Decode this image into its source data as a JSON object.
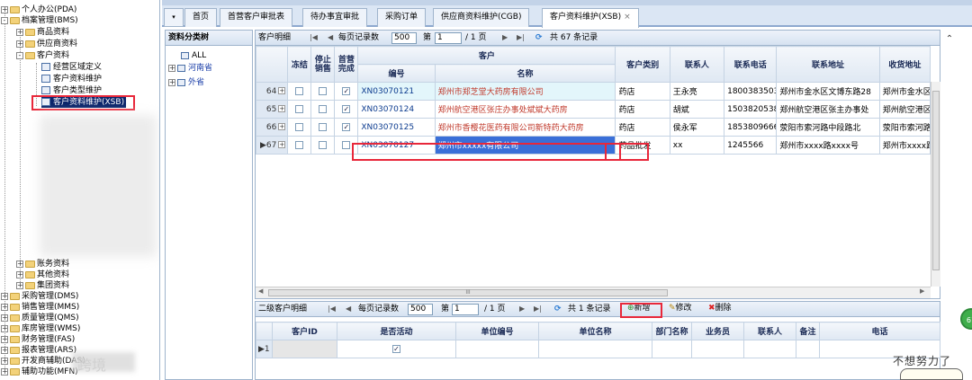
{
  "nav": {
    "items": [
      {
        "label": "个人办公(PDA)",
        "expander": "+",
        "level": 0
      },
      {
        "label": "档案管理(BMS)",
        "expander": "-",
        "level": 0
      },
      {
        "label": "商品资料",
        "expander": "+",
        "level": 1
      },
      {
        "label": "供应商资料",
        "expander": "+",
        "level": 1
      },
      {
        "label": "客户资料",
        "expander": "-",
        "level": 1
      },
      {
        "label": "经营区域定义",
        "level": 2
      },
      {
        "label": "客户资料维护",
        "level": 2
      },
      {
        "label": "客户类型维护",
        "level": 2
      },
      {
        "label": "客户资料维护(XSB)",
        "level": 2
      },
      {
        "label": "账务资料",
        "expander": "+",
        "level": 1
      },
      {
        "label": "其他资料",
        "expander": "+",
        "level": 1
      },
      {
        "label": "集团资料",
        "expander": "+",
        "level": 1
      },
      {
        "label": "采购管理(DMS)",
        "expander": "+",
        "level": 0
      },
      {
        "label": "销售管理(MMS)",
        "expander": "+",
        "level": 0
      },
      {
        "label": "质量管理(QMS)",
        "expander": "+",
        "level": 0
      },
      {
        "label": "库房管理(WMS)",
        "expander": "+",
        "level": 0
      },
      {
        "label": "财务管理(FAS)",
        "expander": "+",
        "level": 0
      },
      {
        "label": "报表管理(ARS)",
        "expander": "+",
        "level": 0
      },
      {
        "label": "开发商辅助(DAS)",
        "expander": "+",
        "level": 0
      },
      {
        "label": "辅助功能(MFN)",
        "expander": "+",
        "level": 0
      }
    ],
    "watermark": "跨境"
  },
  "tabs": {
    "dropdown": "▾",
    "items": [
      {
        "label": "首页"
      },
      {
        "label": "首营客户审批表"
      },
      {
        "label": "待办事宜审批"
      },
      {
        "label": "采购订单"
      },
      {
        "label": "供应商资料维护(CGB)"
      },
      {
        "label": "客户资料维护(XSB)",
        "close": "×",
        "active": true
      }
    ]
  },
  "category": {
    "header": "资料分类树",
    "all": "ALL",
    "nodes": [
      "河南省",
      "外省"
    ]
  },
  "main": {
    "title": "客户明细",
    "page_size_label": "每页记录数",
    "page_size": "500",
    "page_prefix": "第",
    "page": "1",
    "page_total": "/ 1 页",
    "total_label": "共 67 条记录",
    "headers": {
      "frozen": "冻结",
      "stop_sale": "停止销售",
      "first_done": "首营完成",
      "customer": "客户",
      "code": "编号",
      "name": "名称",
      "type": "客户类别",
      "contact": "联系人",
      "phone": "联系电话",
      "address": "联系地址",
      "ship_address": "收货地址"
    },
    "rows": [
      {
        "no": "64",
        "first": "✓",
        "code": "XN03070121",
        "name": "郑州市郑芝堂大药房有限公司",
        "type": "药店",
        "contact": "王永亮",
        "phone": "18003835035",
        "address": "郑州市金水区文博东路28",
        "ship": "郑州市金水区"
      },
      {
        "no": "65",
        "first": "✓",
        "code": "XN03070124",
        "name": "郑州航空港区张庄办事处斌斌大药房",
        "type": "药店",
        "contact": "胡斌",
        "phone": "15038205385",
        "address": "郑州航空港区张主办事处",
        "ship": "郑州航空港区"
      },
      {
        "no": "66",
        "first": "✓",
        "code": "XN03070125",
        "name": "郑州市香樱花医药有限公司新特药大药房",
        "type": "药店",
        "contact": "侯永军",
        "phone": "18538096662",
        "address": "荥阳市索河路中段路北",
        "ship": "荥阳市索河路"
      },
      {
        "no": "67",
        "first": "",
        "code": "XN03070127",
        "name": "郑州市xxxxx有限公司",
        "type": "药品批发",
        "contact": "xx",
        "phone": "1245566",
        "address": "郑州市xxxx路xxxx号",
        "ship": "郑州市xxxx路"
      }
    ],
    "hscroll_mid": "III"
  },
  "sub": {
    "title": "二级客户明细",
    "page_size_label": "每页记录数",
    "page_size": "500",
    "page_prefix": "第",
    "page": "1",
    "page_total": "/ 1 页",
    "total_label": "共 1 条记录",
    "add_label": "新增",
    "edit_label": "修改",
    "delete_label": "删除",
    "headers": [
      "客户ID",
      "是否活动",
      "单位编号",
      "单位名称",
      "部门名称",
      "业务员",
      "联系人",
      "备注",
      "电话"
    ],
    "rows": [
      {
        "no": "1",
        "active": "✓"
      }
    ]
  },
  "side": {
    "badge": "61",
    "sticker": "不想努力了"
  },
  "colors": {
    "accent": "#0a246a",
    "highlight_red": "#e8273a",
    "edit_blue": "#3a6fd8",
    "header_bg": "#dfe8f3"
  }
}
